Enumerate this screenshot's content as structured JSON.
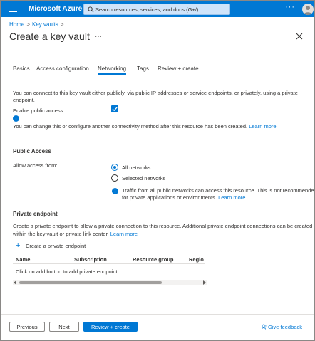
{
  "topbar": {
    "brand": "Microsoft Azure",
    "search_placeholder": "Search resources, services, and docs (G+/)",
    "more": "···"
  },
  "breadcrumb": {
    "items": [
      "Home",
      "Key vaults"
    ],
    "separator": ">"
  },
  "page": {
    "title": "Create a key vault",
    "more": "···"
  },
  "tabs": [
    {
      "label": "Basics",
      "active": false
    },
    {
      "label": "Access configuration",
      "active": false
    },
    {
      "label": "Networking",
      "active": true
    },
    {
      "label": "Tags",
      "active": false
    },
    {
      "label": "Review + create",
      "active": false
    }
  ],
  "networking": {
    "intro": "You can connect to this key vault either publicly, via public IP addresses or service endpoints, or privately, using a private endpoint.",
    "enable_public_access_label": "Enable public access",
    "enable_public_access_checked": true,
    "change_note": "You can change this or configure another connectivity method after this resource has been created.",
    "learn_more": "Learn more"
  },
  "public_access": {
    "heading": "Public Access",
    "allow_label": "Allow access from:",
    "options": [
      {
        "label": "All networks",
        "checked": true
      },
      {
        "label": "Selected networks",
        "checked": false
      }
    ],
    "info_text_line1": "Traffic from all public networks can access this resource. This is not recommended",
    "info_text_line2": "for private applications or environments.",
    "learn_more": "Learn more"
  },
  "private_endpoint": {
    "heading": "Private endpoint",
    "desc_line1": "Create a private endpoint to allow a private connection to this resource. Additional private endpoint connections can be created",
    "desc_line2": "within the key vault or private link center.",
    "learn_more": "Learn more",
    "create_label": "Create a private endpoint",
    "columns": [
      "Name",
      "Subscription",
      "Resource group",
      "Regio"
    ],
    "empty_text": "Click on add button to add private endpoint"
  },
  "footer": {
    "previous": "Previous",
    "next": "Next",
    "review_create": "Review + create",
    "feedback": "Give feedback"
  },
  "colors": {
    "accent": "#0078d4",
    "topbar": "#0078d4"
  }
}
